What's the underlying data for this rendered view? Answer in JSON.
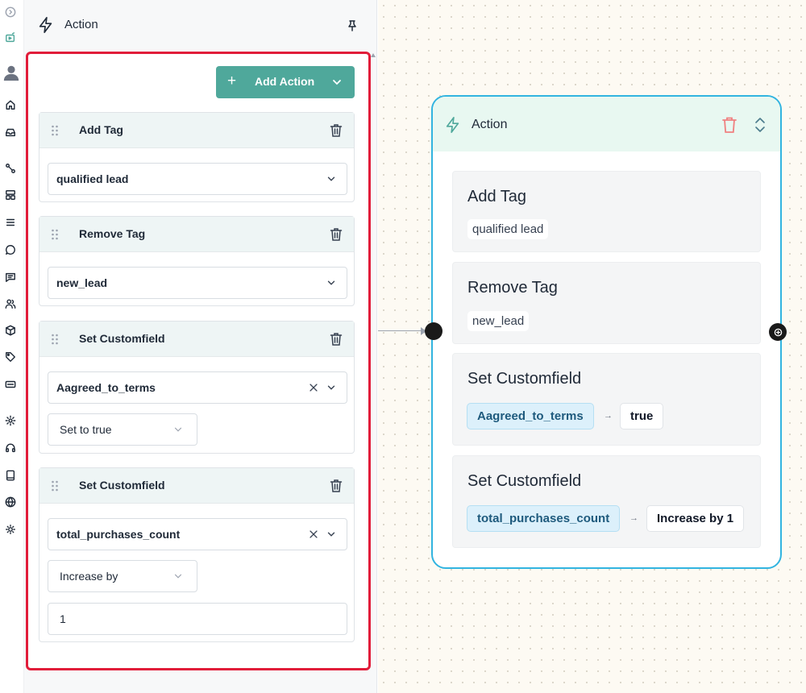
{
  "sidebar": {
    "icons": [
      "expand-icon",
      "chat-preview-icon",
      "user-avatar-icon",
      "home-icon",
      "inbox-icon",
      "flow-icon",
      "layout-icon",
      "menu-icon",
      "message-circle-icon",
      "message-square-icon",
      "users-icon",
      "package-icon",
      "tag-icon",
      "keyboard-icon",
      "settings-icon",
      "headset-icon",
      "book-icon",
      "globe-icon",
      "sun-icon"
    ]
  },
  "panel": {
    "title": "Action",
    "add_action_label": "Add Action",
    "cards": [
      {
        "title": "Add Tag",
        "value": "qualified lead"
      },
      {
        "title": "Remove Tag",
        "value": "new_lead"
      },
      {
        "title": "Set Customfield",
        "field": "Aagreed_to_terms",
        "operation": "Set to true"
      },
      {
        "title": "Set Customfield",
        "field": "total_purchases_count",
        "operation": "Increase by",
        "amount": "1"
      }
    ]
  },
  "node": {
    "title": "Action",
    "blocks": [
      {
        "title": "Add Tag",
        "value": "qualified lead"
      },
      {
        "title": "Remove Tag",
        "value": "new_lead"
      },
      {
        "title": "Set Customfield",
        "field": "Aagreed_to_terms",
        "result": "true"
      },
      {
        "title": "Set Customfield",
        "field": "total_purchases_count",
        "result": "Increase by 1"
      }
    ]
  },
  "colors": {
    "accent_teal": "#4fa89b",
    "highlight_red": "#e11d3a",
    "node_border": "#32b4e0",
    "node_header": "#e8f8f1",
    "trash_red": "#f08080"
  }
}
